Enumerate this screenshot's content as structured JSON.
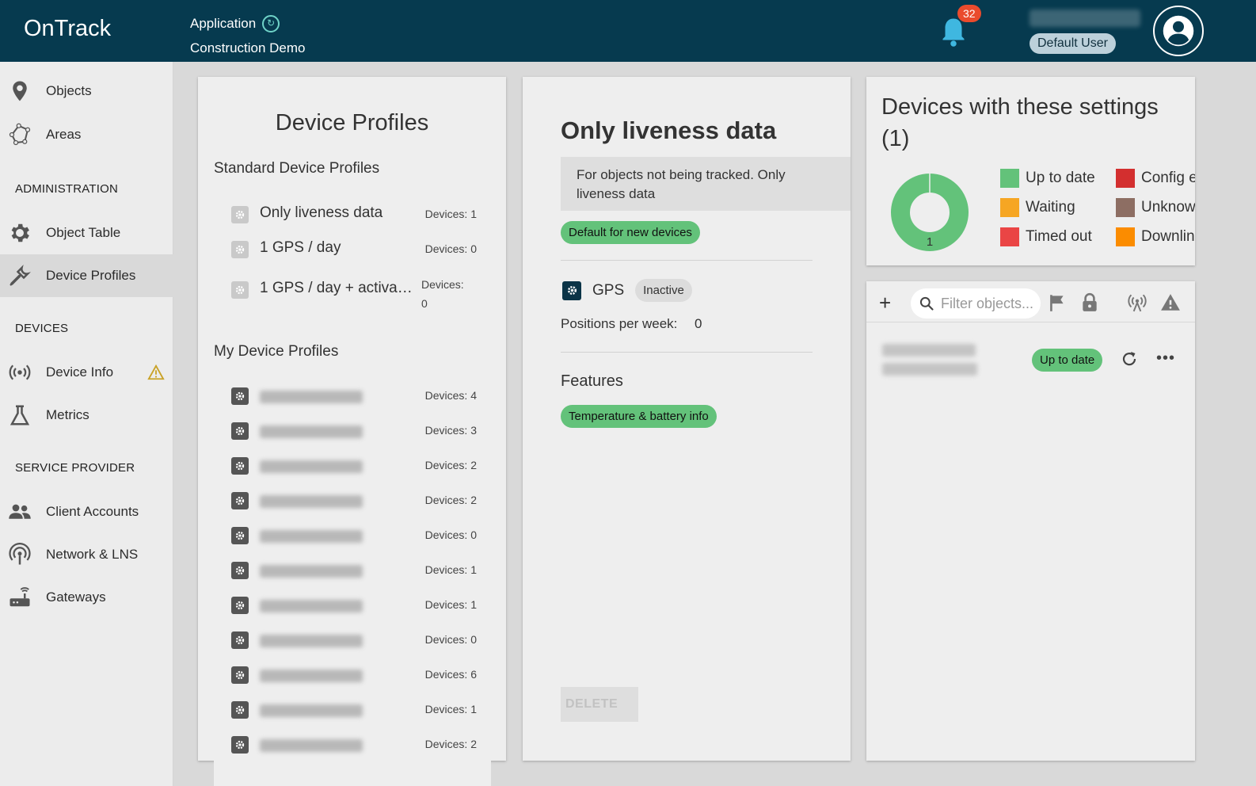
{
  "header": {
    "logo": "OnTrack",
    "app_label": "Application",
    "app_name": "Construction Demo",
    "notification_count": "32",
    "user_role": "Default User"
  },
  "sidebar": {
    "items_top": [
      {
        "label": "Objects",
        "icon": "location-pin-icon"
      },
      {
        "label": "Areas",
        "icon": "polygon-icon"
      }
    ],
    "section_admin": "ADMINISTRATION",
    "items_admin": [
      {
        "label": "Object Table",
        "icon": "gear-icon"
      },
      {
        "label": "Device Profiles",
        "icon": "wrench-icon",
        "active": true
      }
    ],
    "section_devices": "DEVICES",
    "items_devices": [
      {
        "label": "Device Info",
        "icon": "broadcast-icon"
      },
      {
        "label": "Metrics",
        "icon": "flask-icon"
      }
    ],
    "section_sp": "SERVICE PROVIDER",
    "items_sp": [
      {
        "label": "Client Accounts",
        "icon": "people-icon"
      },
      {
        "label": "Network & LNS",
        "icon": "antenna-icon"
      },
      {
        "label": "Gateways",
        "icon": "router-icon"
      }
    ]
  },
  "profiles_panel": {
    "title": "Device Profiles",
    "standard_heading": "Standard Device Profiles",
    "standard": [
      {
        "name": "Only liveness data",
        "devices": "Devices: 1"
      },
      {
        "name": "1 GPS / day",
        "devices": "Devices: 0"
      },
      {
        "name": "1 GPS / day + activa…",
        "devices_label": "Devices:",
        "devices_count": "0"
      }
    ],
    "my_heading": "My Device Profiles",
    "my": [
      {
        "devices": "Devices: 4"
      },
      {
        "devices": "Devices: 3"
      },
      {
        "devices": "Devices: 2"
      },
      {
        "devices": "Devices: 2"
      },
      {
        "devices": "Devices: 0"
      },
      {
        "devices": "Devices: 1"
      },
      {
        "devices": "Devices: 1"
      },
      {
        "devices": "Devices: 0"
      },
      {
        "devices": "Devices: 6"
      },
      {
        "devices": "Devices: 1"
      },
      {
        "devices": "Devices: 2"
      }
    ]
  },
  "detail_panel": {
    "title": "Only liveness data",
    "description": "For objects not being tracked. Only liveness data",
    "default_chip": "Default for new devices",
    "gps_label": "GPS",
    "gps_status": "Inactive",
    "positions_label": "Positions per week:",
    "positions_value": "0",
    "features_heading": "Features",
    "feature_chip": "Temperature & battery info",
    "delete_label": "DELETE"
  },
  "settings_panel": {
    "title": "Devices with these settings (1)",
    "donut_label": "1",
    "legend": [
      {
        "label": "Up to date",
        "color": "#63c27a"
      },
      {
        "label": "Waiting",
        "color": "#f6a623"
      },
      {
        "label": "Timed out",
        "color": "#ea4545"
      },
      {
        "label": "Config e",
        "color": "#d32f2f"
      },
      {
        "label": "Unknow",
        "color": "#8d6e63"
      },
      {
        "label": "Downlin",
        "color": "#fb8c00"
      }
    ]
  },
  "devices_list": {
    "search_placeholder": "Filter objects...",
    "status": "Up to date"
  },
  "colors": {
    "header_bg": "#063a4f",
    "accent_green": "#63c27a",
    "badge_red": "#ea4b2d"
  }
}
